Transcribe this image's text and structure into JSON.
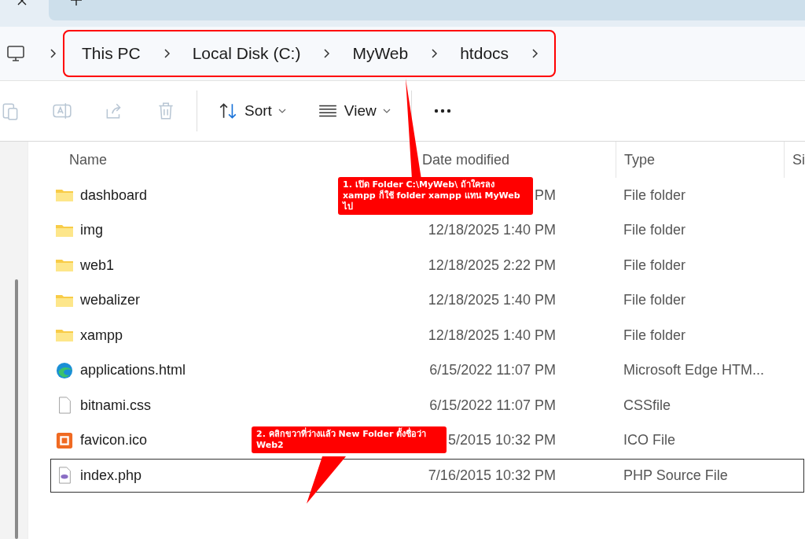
{
  "breadcrumb": [
    "This PC",
    "Local Disk (C:)",
    "MyWeb",
    "htdocs"
  ],
  "toolbar": [
    {
      "kind": "paste",
      "disabled": true
    },
    {
      "kind": "rename",
      "disabled": true
    },
    {
      "kind": "share",
      "disabled": true
    },
    {
      "kind": "delete",
      "disabled": true
    },
    {
      "kind": "sort",
      "label": "Sort"
    },
    {
      "kind": "view",
      "label": "View"
    },
    {
      "kind": "more"
    }
  ],
  "columns": [
    "Name",
    "Date modified",
    "Type",
    "Si"
  ],
  "rows": [
    {
      "kind": "folder",
      "name": "dashboard",
      "date": "PM",
      "type": "File folder",
      "selected": false
    },
    {
      "kind": "folder",
      "name": "img",
      "date": "12/18/2025 1:40 PM",
      "type": "File folder",
      "selected": false
    },
    {
      "kind": "folder",
      "name": "web1",
      "date": "12/18/2025 2:22 PM",
      "type": "File folder",
      "selected": false
    },
    {
      "kind": "folder",
      "name": "webalizer",
      "date": "12/18/2025 1:40 PM",
      "type": "File folder",
      "selected": false
    },
    {
      "kind": "folder",
      "name": "xampp",
      "date": "12/18/2025 1:40 PM",
      "type": "File folder",
      "selected": false
    },
    {
      "kind": "edge",
      "name": "applications.html",
      "date": "6/15/2022 11:07 PM",
      "type": "Microsoft Edge HTM...",
      "selected": false
    },
    {
      "kind": "file",
      "name": "bitnami.css",
      "date": "6/15/2022 11:07 PM",
      "type": "CSSfile",
      "selected": false
    },
    {
      "kind": "xampp",
      "name": "favicon.ico",
      "date": "5/2015 10:32 PM",
      "type": "ICO File",
      "selected": false
    },
    {
      "kind": "php",
      "name": "index.php",
      "date": "7/16/2015 10:32 PM",
      "type": "PHP Source File",
      "selected": true
    }
  ],
  "annotations": [
    "1. เปิด Folder C:\\MyWeb\\ ถ้าใครลง xampp ก็ใช้ folder xampp แทน MyWeb ไป",
    "2. คลิกขวาที่ว่างแล้ว New Folder ตั้งชื่อว่า Web2"
  ]
}
